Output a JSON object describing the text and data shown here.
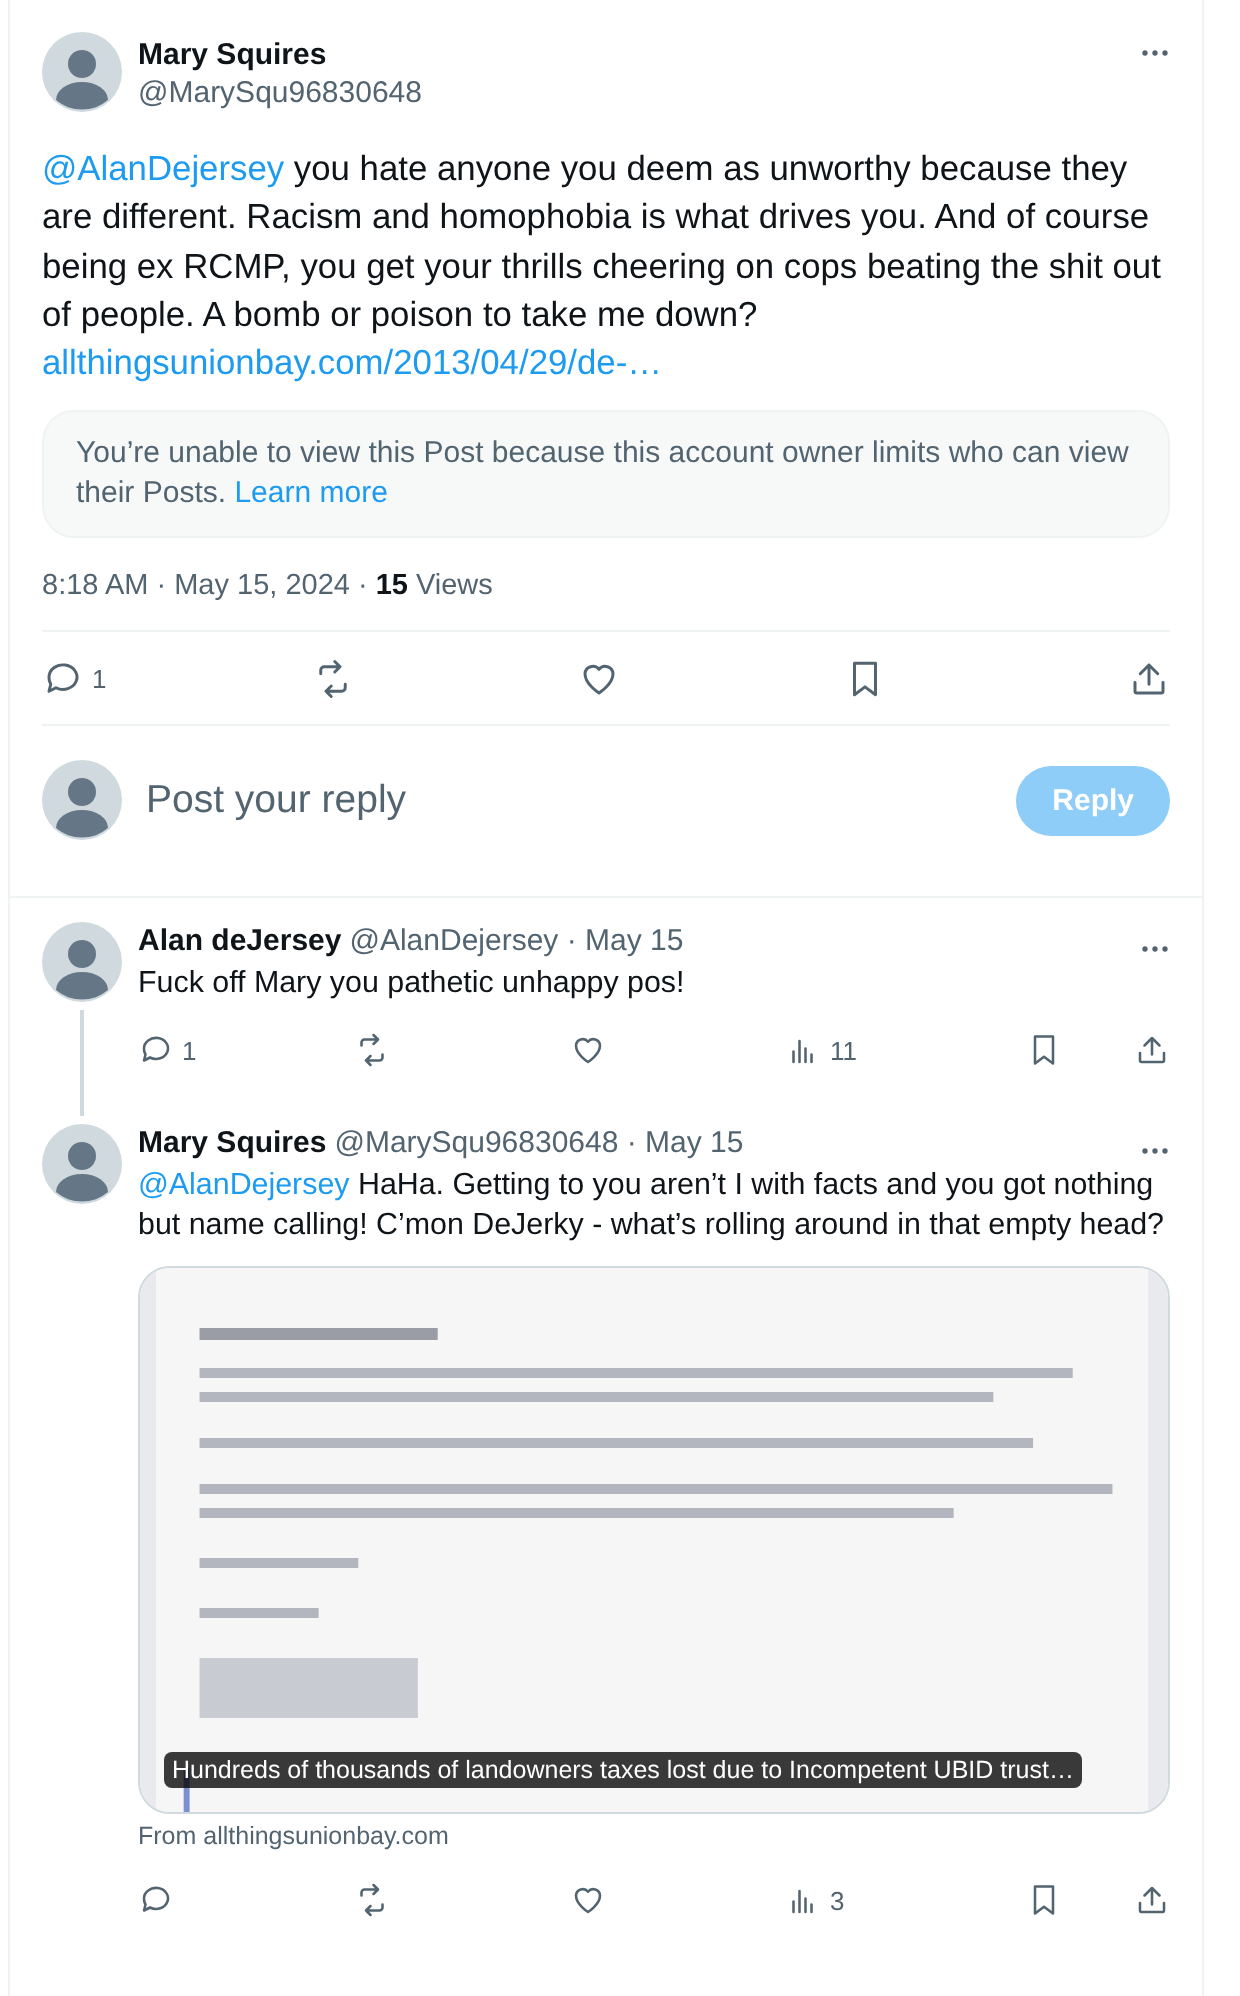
{
  "main_post": {
    "author": {
      "name": "Mary Squires",
      "handle": "@MarySqu96830648"
    },
    "mention": "@AlanDejersey",
    "text": "you hate anyone you deem as unworthy because they are different. Racism and homophobia is what drives you. And of course being ex RCMP, you get your thrills cheering on cops beating the shit out of people. A bomb or poison to take me down?",
    "link": "allthingsunionbay.com/2013/04/29/de-…",
    "notice": {
      "text": "You’re unable to view this Post because this account owner limits who can view their Posts.",
      "link": "Learn more"
    },
    "timestamp": "8:18 AM · May 15, 2024 ·",
    "views_count": "15",
    "views_label": "Views",
    "actions": [
      {
        "kind": "reply",
        "count": "1"
      },
      {
        "kind": "repost"
      },
      {
        "kind": "like"
      },
      {
        "kind": "bookmark"
      },
      {
        "kind": "share"
      }
    ]
  },
  "compose": {
    "placeholder": "Post your reply",
    "button": "Reply",
    "disabled": true
  },
  "replies": [
    {
      "author": {
        "name": "Alan deJersey",
        "handle_date": "@AlanDejersey · May 15"
      },
      "thread_line": true,
      "text": "Fuck off Mary you pathetic unhappy pos!",
      "actions": [
        {
          "kind": "reply",
          "count": "1"
        },
        {
          "kind": "repost"
        },
        {
          "kind": "like"
        },
        {
          "kind": "views",
          "count": "11"
        },
        {
          "kind": "bookmark"
        },
        {
          "kind": "share"
        }
      ]
    },
    {
      "author": {
        "name": "Mary Squires",
        "handle_date": "@MarySqu96830648 · May 15"
      },
      "thread_line": false,
      "mention": "@AlanDejersey",
      "text": "HaHa. Getting to you aren’t I with facts and you got nothing but name calling!  C’mon DeJerky - what’s rolling around in that empty head?",
      "card": {
        "kind": "picture",
        "title": "Hundreds of thousands of landowners taxes lost due to Incompetent UBID trust…",
        "source": "From allthingsunionbay.com"
      },
      "actions": [
        {
          "kind": "reply"
        },
        {
          "kind": "repost"
        },
        {
          "kind": "like"
        },
        {
          "kind": "views",
          "count": "3"
        },
        {
          "kind": "bookmark"
        },
        {
          "kind": "share"
        }
      ]
    }
  ]
}
